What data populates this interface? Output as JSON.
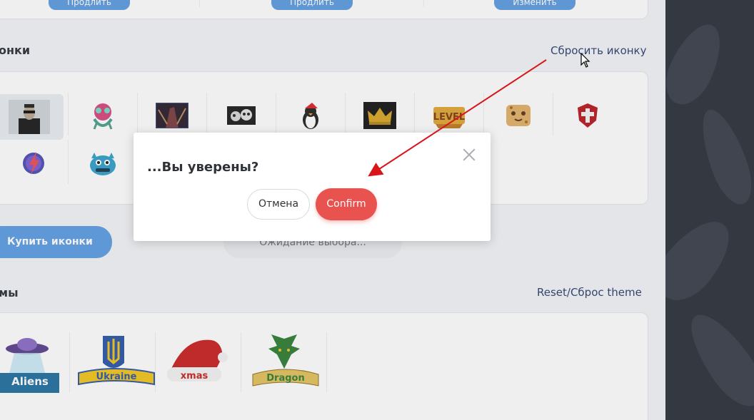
{
  "top_card": {
    "buttons": [
      "Продлить",
      "Продлить",
      "Изменить"
    ]
  },
  "icons_section": {
    "title": "онки",
    "reset_link": "Сбросить иконку",
    "icons": [
      {
        "name": "neo-matrix-icon",
        "selected": true
      },
      {
        "name": "alien-creature-icon"
      },
      {
        "name": "dark-warrior-icon"
      },
      {
        "name": "skull-pile-icon"
      },
      {
        "name": "santa-penguin-icon"
      },
      {
        "name": "gold-crown-icon"
      },
      {
        "name": "level-badge-icon"
      },
      {
        "name": "cookie-face-icon"
      },
      {
        "name": "red-shield-icon"
      },
      {
        "name": "lightning-emblem-icon"
      },
      {
        "name": "blue-monster-icon"
      }
    ]
  },
  "actions": {
    "buy_label": "Купить иконки",
    "waiting_label": "Ожидание выбора..."
  },
  "themes_section": {
    "title": "мы",
    "reset_link": "Reset/Сброс theme",
    "themes": [
      {
        "label": "Aliens",
        "color": "#1f6f9e"
      },
      {
        "label": "Ukraine",
        "color": "#2a55a8"
      },
      {
        "label": "xmas",
        "color": "#c8201e"
      },
      {
        "label": "Dragon",
        "color": "#2e7d32"
      }
    ]
  },
  "modal": {
    "title": "...Вы уверены?",
    "cancel_label": "Отмена",
    "confirm_label": "Confirm"
  },
  "colors": {
    "accent_blue": "#5b9de3",
    "confirm_red": "#e8534f",
    "arrow_red": "#d9141a",
    "link": "#2a3f6b"
  }
}
